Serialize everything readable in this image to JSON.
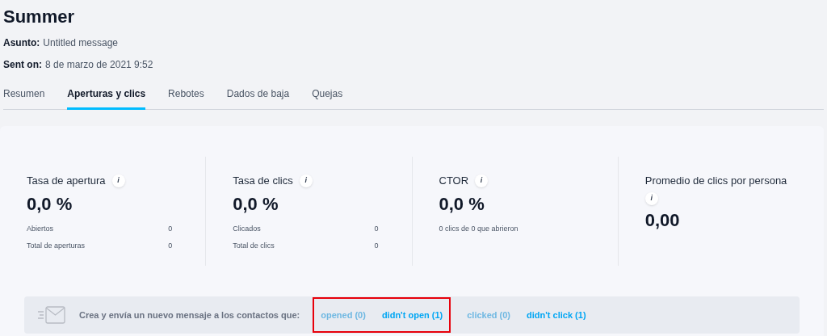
{
  "title": "Summer",
  "meta": [
    {
      "label": "Asunto:",
      "value": "Untitled message"
    },
    {
      "label": "Sent on:",
      "value": "8 de marzo de 2021 9:52"
    }
  ],
  "tabs": [
    {
      "label": "Resumen",
      "selected": false
    },
    {
      "label": "Aperturas y clics",
      "selected": true
    },
    {
      "label": "Rebotes",
      "selected": false
    },
    {
      "label": "Dados de baja",
      "selected": false
    },
    {
      "label": "Quejas",
      "selected": false
    }
  ],
  "stats": [
    {
      "title": "Tasa de apertura",
      "info": "i",
      "value": "0,0 %",
      "rows": [
        {
          "label": "Abiertos",
          "value": "0"
        },
        {
          "label": "Total de aperturas",
          "value": "0"
        }
      ]
    },
    {
      "title": "Tasa de clics",
      "info": "i",
      "value": "0,0 %",
      "rows": [
        {
          "label": "Clicados",
          "value": "0"
        },
        {
          "label": "Total de clics",
          "value": "0"
        }
      ]
    },
    {
      "title": "CTOR",
      "info": "i",
      "value": "0,0 %",
      "note": "0 clics de 0 que abrieron"
    },
    {
      "title": "Promedio de clics por persona",
      "info": "i",
      "value": "0,00"
    }
  ],
  "resend": {
    "text": "Crea y envía un nuevo mensaje a los contactos que:",
    "links": [
      {
        "label": "opened (0)",
        "disabled": true,
        "highlighted": true
      },
      {
        "label": "didn't open (1)",
        "disabled": false,
        "highlighted": true
      },
      {
        "label": "clicked (0)",
        "disabled": true,
        "highlighted": false
      },
      {
        "label": "didn't click (1)",
        "disabled": false,
        "highlighted": false
      }
    ]
  }
}
